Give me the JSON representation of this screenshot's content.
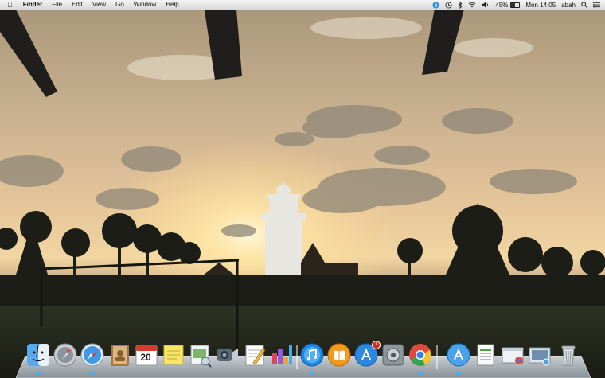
{
  "menubar": {
    "apple_icon": "apple-logo-icon",
    "app_name": "Finder",
    "menus": [
      "File",
      "Edit",
      "View",
      "Go",
      "Window",
      "Help"
    ],
    "battery_percent": "45%",
    "battery_level": 0.45,
    "clock": "Mon 14:05",
    "user": "abah",
    "status_icons": [
      "skype-icon",
      "clock-icon",
      "bluetooth-icon",
      "wifi-icon",
      "volume-icon",
      "battery-icon",
      "search-icon",
      "notifications-list-icon"
    ]
  },
  "desktop": {
    "wallpaper": "sunset-silhouette-mosque-tower-palms"
  },
  "dock": {
    "apps": [
      "finder",
      "launchpad",
      "safari",
      "contacts",
      "calendar",
      "stickies",
      "preview",
      "facetime",
      "textedit",
      "keynote-chart",
      "itunes",
      "ibooks",
      "app-store",
      "system-preferences",
      "chrome",
      "app-store-blue",
      "numbers",
      "mail-browser",
      "photo-viewer",
      "trash"
    ],
    "calendar_day": "20",
    "app_store_badge": "1",
    "accent": "#39b3ff"
  }
}
